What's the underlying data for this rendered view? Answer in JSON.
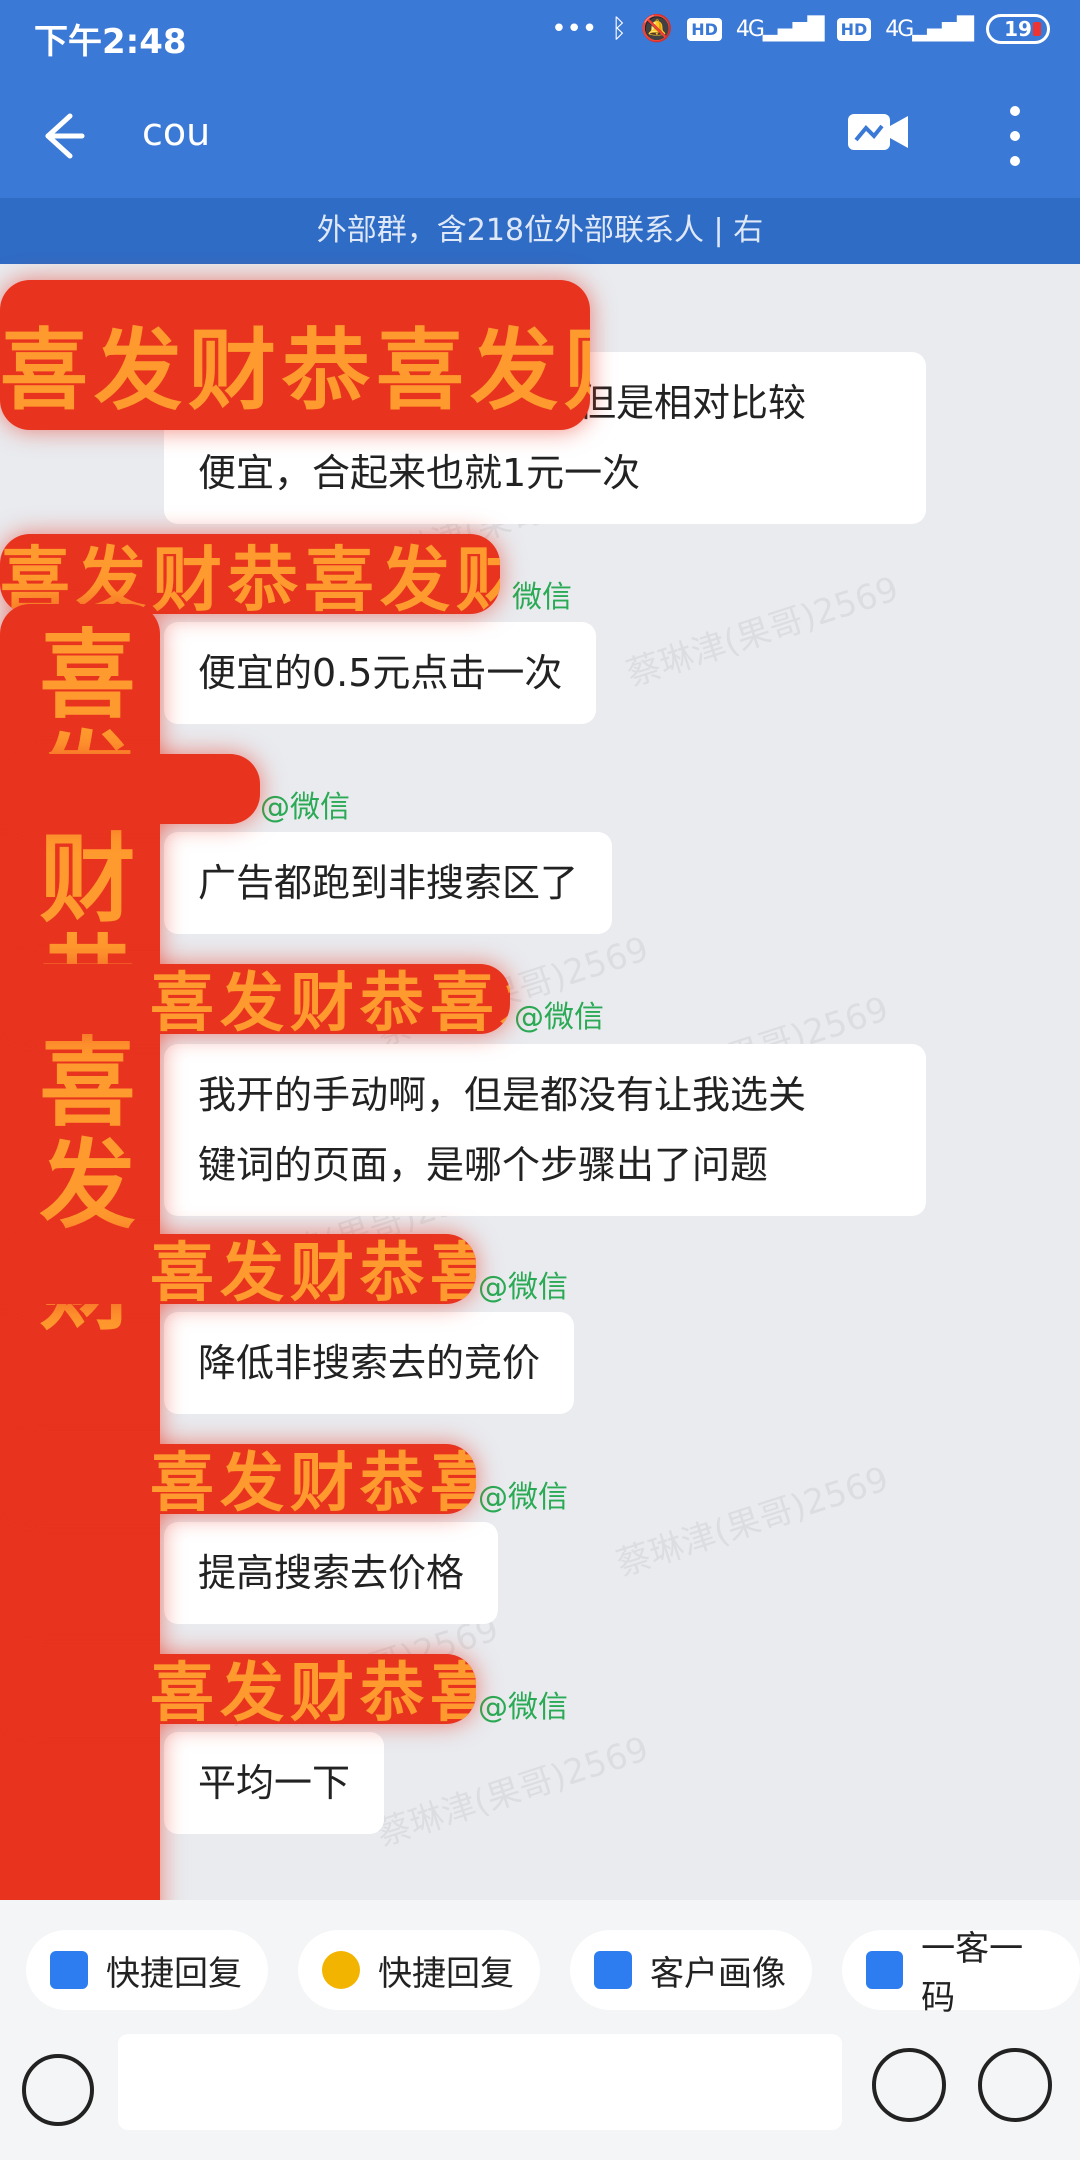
{
  "status_bar": {
    "time": "下午2:48",
    "battery": "19",
    "hd1": "HD",
    "hd2": "HD",
    "net": "4G"
  },
  "header": {
    "title": "cou",
    "subtitle": "外部群，含218位外部联系人 | 右"
  },
  "messages": [
    {
      "sender": "",
      "text_lines": [
        "凑胖也有关键词竞价，但是相对比较",
        "便宜，合起来也就1元一次"
      ]
    },
    {
      "sender": "微信",
      "text_lines": [
        "便宜的0.5元点击一次"
      ]
    },
    {
      "sender": "@微信",
      "text_lines": [
        "广告都跑到非搜索区了"
      ]
    },
    {
      "sender": "@微信",
      "text_lines": [
        "我开的手动啊，但是都没有让我选关",
        "键词的页面，是哪个步骤出了问题"
      ]
    },
    {
      "sender": "@微信",
      "text_lines": [
        "降低非搜索去的竞价"
      ]
    },
    {
      "sender": "@微信",
      "text_lines": [
        "提高搜索去价格"
      ]
    },
    {
      "sender": "@微信",
      "text_lines": [
        "平均一下"
      ]
    }
  ],
  "watermark": "蔡琳津(果哥)2569",
  "stickers_text": "喜发财恭喜发财",
  "quick_actions": [
    {
      "label": "快捷回复",
      "icon": "checkbox-icon"
    },
    {
      "label": "快捷回复",
      "icon": "note-icon"
    },
    {
      "label": "客户画像",
      "icon": "checkbox-icon"
    },
    {
      "label": "一客一码",
      "icon": "checkbox-icon"
    }
  ],
  "colors": {
    "header_bg": "#3b79d6",
    "sender_green": "#2aaa55",
    "sticker_red": "#e8341f",
    "sticker_orange": "#ff9a2e"
  }
}
